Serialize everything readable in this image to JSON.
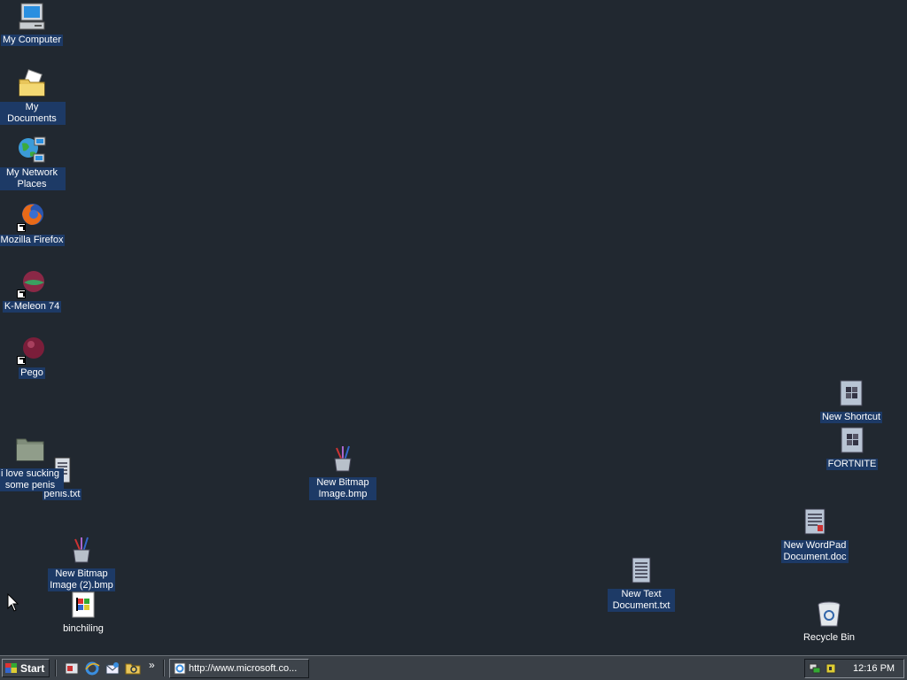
{
  "desktop": {
    "icons": {
      "my_computer": "My Computer",
      "my_documents": "My Documents",
      "my_network_places": "My Network Places",
      "firefox": "Mozilla Firefox",
      "kmeleon": "K-Meleon 74",
      "pego": "Pego",
      "folder": "i love sucking some penis",
      "penis_txt": "penis.txt",
      "bitmap1": "New Bitmap Image.bmp",
      "bitmap2": "New Bitmap Image (2).bmp",
      "binchiling": "binchiling",
      "new_shortcut": "New Shortcut",
      "fortnite": "FORTNITE",
      "wordpad_doc": "New WordPad Document.doc",
      "text_doc": "New Text Document.txt",
      "recycle_bin": "Recycle Bin"
    }
  },
  "taskbar": {
    "start_label": "Start",
    "chevron": "»",
    "task_button": "http://www.microsoft.co...",
    "clock": "12:16 PM"
  },
  "colors": {
    "desktop_bg": "#212830",
    "label_bg": "#1d3a66",
    "taskbar_bg": "#3a4047"
  }
}
